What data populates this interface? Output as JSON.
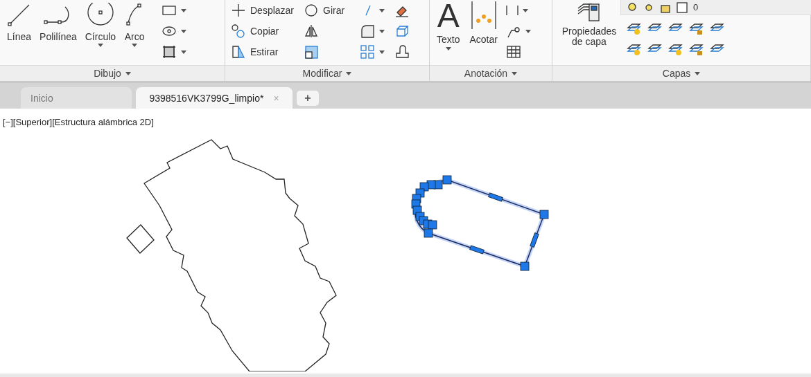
{
  "ribbon": {
    "panels": [
      {
        "kind": "draw",
        "title": "Dibujo",
        "tools": [
          {
            "label": "Línea",
            "dropdown": false
          },
          {
            "label": "Polilínea",
            "dropdown": false
          },
          {
            "label": "Círculo",
            "dropdown": true
          },
          {
            "label": "Arco",
            "dropdown": true
          }
        ]
      },
      {
        "kind": "modify",
        "title": "Modificar",
        "tools": [
          {
            "label": "Desplazar"
          },
          {
            "label": "Girar"
          },
          {
            "label": "Copiar"
          },
          {
            "label": "Estirar"
          }
        ]
      },
      {
        "kind": "annotate",
        "title": "Anotación",
        "tools": [
          {
            "label": "Texto",
            "glyph": "A",
            "dropdown": true
          },
          {
            "label": "Acotar",
            "dropdown": false
          }
        ]
      },
      {
        "kind": "layers",
        "title": "Capas",
        "tools": [
          {
            "label": "Propiedades de capa"
          }
        ],
        "layer": "0"
      }
    ]
  },
  "tabs": [
    {
      "label": "Inicio",
      "selected": false
    },
    {
      "label": "9398516VK3799G_limpio*",
      "selected": true,
      "close": "×"
    }
  ],
  "new_tab": "+",
  "viewport": {
    "label": "[−][Superior][Estructura alámbrica 2D]"
  }
}
